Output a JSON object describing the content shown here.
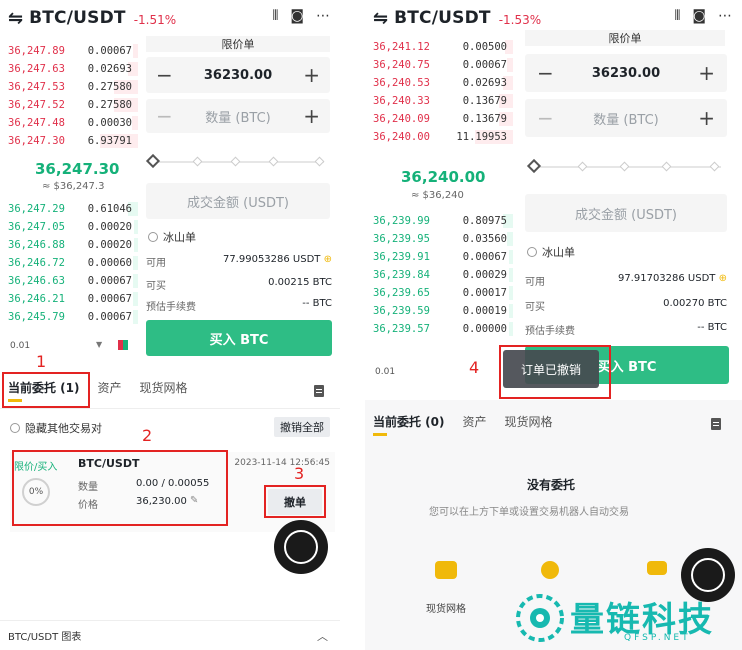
{
  "left": {
    "header": {
      "pair": "BTC/USDT",
      "change": "-1.51%"
    },
    "asks": [
      {
        "p": "36,247.89",
        "q": "0.00067",
        "d": 0.12
      },
      {
        "p": "36,247.63",
        "q": "0.02693",
        "d": 0.25
      },
      {
        "p": "36,247.53",
        "q": "0.27580",
        "d": 0.6
      },
      {
        "p": "36,247.52",
        "q": "0.27580",
        "d": 0.6
      },
      {
        "p": "36,247.48",
        "q": "0.00030",
        "d": 0.15
      },
      {
        "p": "36,247.30",
        "q": "6.93791",
        "d": 0.95
      }
    ],
    "last_price": "36,247.30",
    "last_fiat": "≈ $36,247.3",
    "bids": [
      {
        "p": "36,247.29",
        "q": "0.61046",
        "d": 0.5
      },
      {
        "p": "36,247.05",
        "q": "0.00020",
        "d": 0.2
      },
      {
        "p": "36,246.88",
        "q": "0.00020",
        "d": 0.2
      },
      {
        "p": "36,246.72",
        "q": "0.00060",
        "d": 0.25
      },
      {
        "p": "36,246.63",
        "q": "0.00067",
        "d": 0.25
      },
      {
        "p": "36,246.21",
        "q": "0.00067",
        "d": 0.25
      },
      {
        "p": "36,245.79",
        "q": "0.00067",
        "d": 0.25
      }
    ],
    "depth": "0.01",
    "order_type": "限价单",
    "price_value": "36230.00",
    "qty_placeholder": "数量 (BTC)",
    "amount_placeholder": "成交金额 (USDT)",
    "iceberg": "冰山单",
    "available_label": "可用",
    "available_value": "77.99053286 USDT",
    "buyable_label": "可买",
    "buyable_value": "0.00215 BTC",
    "fee_label": "预估手续费",
    "fee_value": "-- BTC",
    "buy_label": "买入 BTC",
    "tabs": [
      "当前委托 (1)",
      "资产",
      "现货网格"
    ],
    "hide_others": "隐藏其他交易对",
    "cancel_all": "撤销全部",
    "order": {
      "type": "限价/买入",
      "pair": "BTC/USDT",
      "time": "2023-11-14 12:56:45",
      "progress": "0%",
      "qty_label": "数量",
      "qty_value": "0.00 / 0.00055",
      "price_label": "价格",
      "price_value": "36,230.00",
      "cancel": "撤单"
    },
    "bottom": "BTC/USDT 图表",
    "annotations": [
      "1",
      "2",
      "3"
    ]
  },
  "right": {
    "header": {
      "pair": "BTC/USDT",
      "change": "-1.53%"
    },
    "asks": [
      {
        "p": "36,241.12",
        "q": "0.00500",
        "d": 0.2
      },
      {
        "p": "36,240.75",
        "q": "0.00067",
        "d": 0.15
      },
      {
        "p": "36,240.53",
        "q": "0.02693",
        "d": 0.25
      },
      {
        "p": "36,240.33",
        "q": "0.13679",
        "d": 0.35
      },
      {
        "p": "36,240.09",
        "q": "0.13679",
        "d": 0.35
      },
      {
        "p": "36,240.00",
        "q": "11.19953",
        "d": 0.95
      }
    ],
    "last_price": "36,240.00",
    "last_fiat": "≈ $36,240",
    "bids": [
      {
        "p": "36,239.99",
        "q": "0.80975",
        "d": 0.5
      },
      {
        "p": "36,239.95",
        "q": "0.03560",
        "d": 0.3
      },
      {
        "p": "36,239.91",
        "q": "0.00067",
        "d": 0.2
      },
      {
        "p": "36,239.84",
        "q": "0.00029",
        "d": 0.2
      },
      {
        "p": "36,239.65",
        "q": "0.00017",
        "d": 0.2
      },
      {
        "p": "36,239.59",
        "q": "0.00019",
        "d": 0.2
      },
      {
        "p": "36,239.57",
        "q": "0.00000",
        "d": 0.2
      }
    ],
    "depth": "0.01",
    "order_type": "限价单",
    "price_value": "36230.00",
    "qty_placeholder": "数量 (BTC)",
    "amount_placeholder": "成交金额 (USDT)",
    "iceberg": "冰山单",
    "available_label": "可用",
    "available_value": "97.91703286 USDT",
    "buyable_label": "可买",
    "buyable_value": "0.00270 BTC",
    "fee_label": "预估手续费",
    "fee_value": "-- BTC",
    "buy_label": "买入 BTC",
    "tabs": [
      "当前委托 (0)",
      "资产",
      "现货网格"
    ],
    "toast": "订单已撤销",
    "empty_title": "没有委托",
    "empty_sub": "您可以在上方下单或设置交易机器人自动交易",
    "grid_label": "现货网格",
    "annotation": "4"
  },
  "watermark": {
    "brand": "量链科技",
    "site": "QFSP.NET"
  },
  "colors": {
    "up": "#15b179",
    "down": "#e0304a",
    "accent": "#f0b90b",
    "buy": "#2ebd85",
    "annotation": "#e32322",
    "watermark": "#17b9b0"
  }
}
